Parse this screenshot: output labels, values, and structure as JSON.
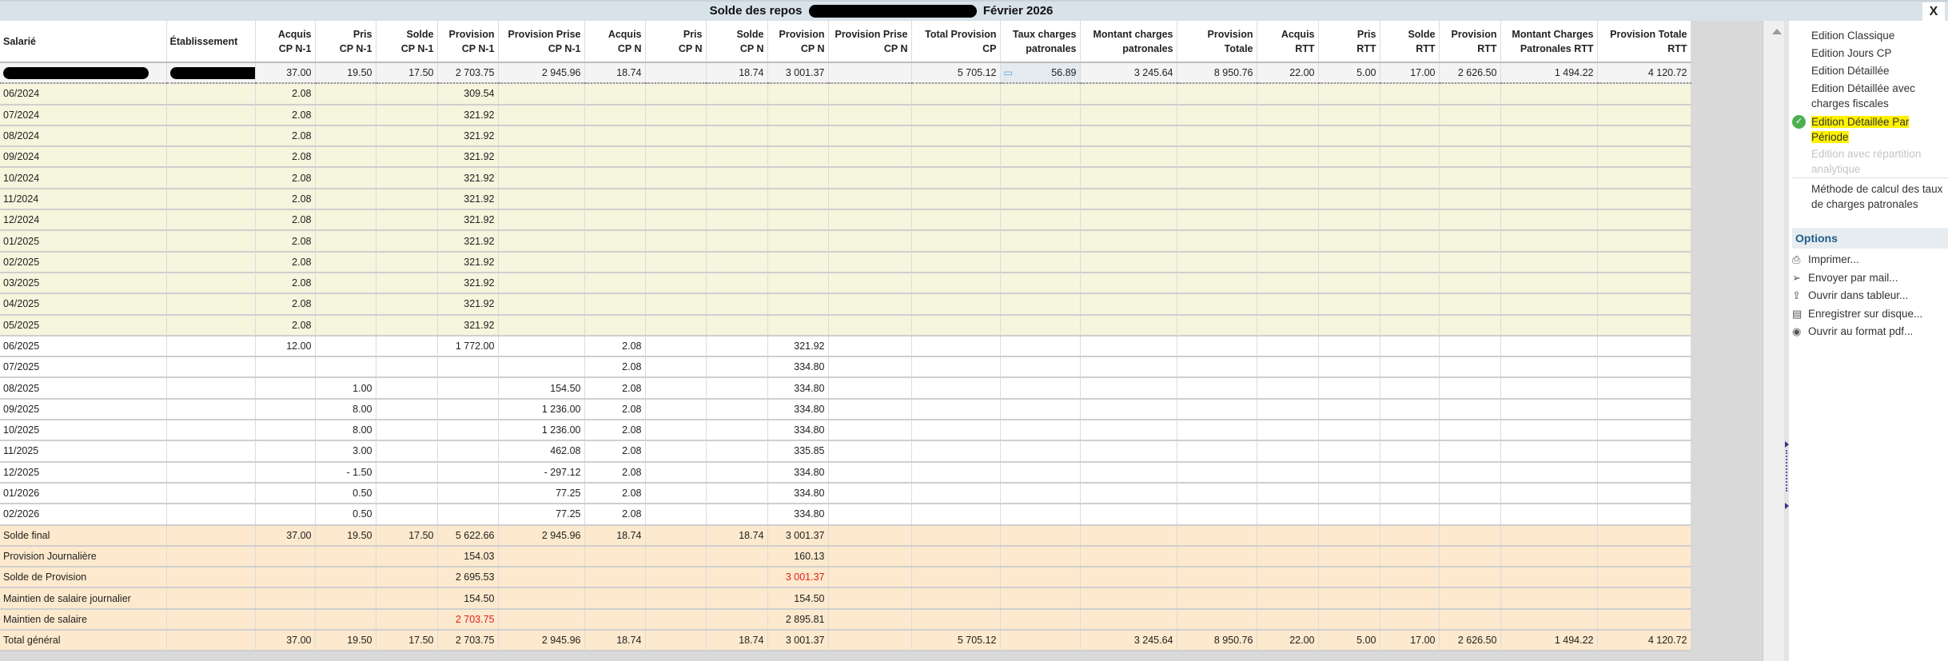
{
  "window": {
    "title_prefix": "Solde des repos",
    "title_suffix": "Février 2026",
    "close_label": "X"
  },
  "columns": [
    [
      "Salarié",
      ""
    ],
    [
      "Établissement",
      ""
    ],
    [
      "Acquis",
      "CP N-1"
    ],
    [
      "Pris",
      "CP N-1"
    ],
    [
      "Solde",
      "CP N-1"
    ],
    [
      "Provision",
      "CP N-1"
    ],
    [
      "Provision Prise",
      "CP N-1"
    ],
    [
      "Acquis",
      "CP N"
    ],
    [
      "Pris",
      "CP N"
    ],
    [
      "Solde",
      "CP N"
    ],
    [
      "Provision",
      "CP N"
    ],
    [
      "Provision Prise",
      "CP N"
    ],
    [
      "Total Provision",
      "CP"
    ],
    [
      "Taux charges",
      "patronales"
    ],
    [
      "Montant charges",
      "patronales"
    ],
    [
      "Provision",
      "Totale"
    ],
    [
      "Acquis",
      "RTT"
    ],
    [
      "Pris",
      "RTT"
    ],
    [
      "Solde",
      "RTT"
    ],
    [
      "Provision",
      "RTT"
    ],
    [
      "Montant Charges",
      "Patronales RTT"
    ],
    [
      "Provision Totale",
      "RTT"
    ]
  ],
  "summary": {
    "values": [
      "37.00",
      "19.50",
      "17.50",
      "2 703.75",
      "2 945.96",
      "18.74",
      "",
      "18.74",
      "3 001.37",
      "",
      "5 705.12",
      "56.89",
      "3 245.64",
      "8 950.76",
      "22.00",
      "5.00",
      "17.00",
      "2 626.50",
      "1 494.22",
      "4 120.72"
    ]
  },
  "rows": [
    {
      "label": "06/2024",
      "style": "yellow",
      "values": [
        "2.08",
        "",
        "",
        "309.54",
        "",
        "",
        "",
        "",
        "",
        "",
        "",
        "",
        "",
        "",
        "",
        "",
        "",
        "",
        "",
        ""
      ]
    },
    {
      "label": "07/2024",
      "style": "yellow",
      "values": [
        "2.08",
        "",
        "",
        "321.92",
        "",
        "",
        "",
        "",
        "",
        "",
        "",
        "",
        "",
        "",
        "",
        "",
        "",
        "",
        "",
        ""
      ]
    },
    {
      "label": "08/2024",
      "style": "yellow",
      "values": [
        "2.08",
        "",
        "",
        "321.92",
        "",
        "",
        "",
        "",
        "",
        "",
        "",
        "",
        "",
        "",
        "",
        "",
        "",
        "",
        "",
        ""
      ]
    },
    {
      "label": "09/2024",
      "style": "yellow",
      "values": [
        "2.08",
        "",
        "",
        "321.92",
        "",
        "",
        "",
        "",
        "",
        "",
        "",
        "",
        "",
        "",
        "",
        "",
        "",
        "",
        "",
        ""
      ]
    },
    {
      "label": "10/2024",
      "style": "yellow",
      "values": [
        "2.08",
        "",
        "",
        "321.92",
        "",
        "",
        "",
        "",
        "",
        "",
        "",
        "",
        "",
        "",
        "",
        "",
        "",
        "",
        "",
        ""
      ]
    },
    {
      "label": "11/2024",
      "style": "yellow",
      "values": [
        "2.08",
        "",
        "",
        "321.92",
        "",
        "",
        "",
        "",
        "",
        "",
        "",
        "",
        "",
        "",
        "",
        "",
        "",
        "",
        "",
        ""
      ]
    },
    {
      "label": "12/2024",
      "style": "yellow",
      "values": [
        "2.08",
        "",
        "",
        "321.92",
        "",
        "",
        "",
        "",
        "",
        "",
        "",
        "",
        "",
        "",
        "",
        "",
        "",
        "",
        "",
        ""
      ]
    },
    {
      "label": "01/2025",
      "style": "yellow",
      "values": [
        "2.08",
        "",
        "",
        "321.92",
        "",
        "",
        "",
        "",
        "",
        "",
        "",
        "",
        "",
        "",
        "",
        "",
        "",
        "",
        "",
        ""
      ]
    },
    {
      "label": "02/2025",
      "style": "yellow",
      "values": [
        "2.08",
        "",
        "",
        "321.92",
        "",
        "",
        "",
        "",
        "",
        "",
        "",
        "",
        "",
        "",
        "",
        "",
        "",
        "",
        "",
        ""
      ]
    },
    {
      "label": "03/2025",
      "style": "yellow",
      "values": [
        "2.08",
        "",
        "",
        "321.92",
        "",
        "",
        "",
        "",
        "",
        "",
        "",
        "",
        "",
        "",
        "",
        "",
        "",
        "",
        "",
        ""
      ]
    },
    {
      "label": "04/2025",
      "style": "yellow",
      "values": [
        "2.08",
        "",
        "",
        "321.92",
        "",
        "",
        "",
        "",
        "",
        "",
        "",
        "",
        "",
        "",
        "",
        "",
        "",
        "",
        "",
        ""
      ]
    },
    {
      "label": "05/2025",
      "style": "yellow",
      "values": [
        "2.08",
        "",
        "",
        "321.92",
        "",
        "",
        "",
        "",
        "",
        "",
        "",
        "",
        "",
        "",
        "",
        "",
        "",
        "",
        "",
        ""
      ]
    },
    {
      "label": "06/2025",
      "style": "white",
      "values": [
        "12.00",
        "",
        "",
        "1 772.00",
        "",
        "2.08",
        "",
        "",
        "321.92",
        "",
        "",
        "",
        "",
        "",
        "",
        "",
        "",
        "",
        "",
        ""
      ]
    },
    {
      "label": "07/2025",
      "style": "white",
      "values": [
        "",
        "",
        "",
        "",
        "",
        "2.08",
        "",
        "",
        "334.80",
        "",
        "",
        "",
        "",
        "",
        "",
        "",
        "",
        "",
        "",
        ""
      ]
    },
    {
      "label": "08/2025",
      "style": "white",
      "values": [
        "",
        "1.00",
        "",
        "",
        "154.50",
        "2.08",
        "",
        "",
        "334.80",
        "",
        "",
        "",
        "",
        "",
        "",
        "",
        "",
        "",
        "",
        ""
      ]
    },
    {
      "label": "09/2025",
      "style": "white",
      "values": [
        "",
        "8.00",
        "",
        "",
        "1 236.00",
        "2.08",
        "",
        "",
        "334.80",
        "",
        "",
        "",
        "",
        "",
        "",
        "",
        "",
        "",
        "",
        ""
      ]
    },
    {
      "label": "10/2025",
      "style": "white",
      "values": [
        "",
        "8.00",
        "",
        "",
        "1 236.00",
        "2.08",
        "",
        "",
        "334.80",
        "",
        "",
        "",
        "",
        "",
        "",
        "",
        "",
        "",
        "",
        ""
      ]
    },
    {
      "label": "11/2025",
      "style": "white",
      "values": [
        "",
        "3.00",
        "",
        "",
        "462.08",
        "2.08",
        "",
        "",
        "335.85",
        "",
        "",
        "",
        "",
        "",
        "",
        "",
        "",
        "",
        "",
        ""
      ]
    },
    {
      "label": "12/2025",
      "style": "white",
      "values": [
        "",
        "- 1.50",
        "",
        "",
        "- 297.12",
        "2.08",
        "",
        "",
        "334.80",
        "",
        "",
        "",
        "",
        "",
        "",
        "",
        "",
        "",
        "",
        ""
      ]
    },
    {
      "label": "01/2026",
      "style": "white",
      "values": [
        "",
        "0.50",
        "",
        "",
        "77.25",
        "2.08",
        "",
        "",
        "334.80",
        "",
        "",
        "",
        "",
        "",
        "",
        "",
        "",
        "",
        "",
        ""
      ]
    },
    {
      "label": "02/2026",
      "style": "white",
      "values": [
        "",
        "0.50",
        "",
        "",
        "77.25",
        "2.08",
        "",
        "",
        "334.80",
        "",
        "",
        "",
        "",
        "",
        "",
        "",
        "",
        "",
        "",
        ""
      ]
    },
    {
      "label": "Solde final",
      "style": "orange",
      "values": [
        "37.00",
        "19.50",
        "17.50",
        "5 622.66",
        "2 945.96",
        "18.74",
        "",
        "18.74",
        "3 001.37",
        "",
        "",
        "",
        "",
        "",
        "",
        "",
        "",
        "",
        "",
        ""
      ]
    },
    {
      "label": "Provision Journalière",
      "style": "orange",
      "values": [
        "",
        "",
        "",
        "154.03",
        "",
        "",
        "",
        "",
        "160.13",
        "",
        "",
        "",
        "",
        "",
        "",
        "",
        "",
        "",
        "",
        ""
      ]
    },
    {
      "label": "Solde de Provision",
      "style": "orange",
      "red": [
        8
      ],
      "values": [
        "",
        "",
        "",
        "2 695.53",
        "",
        "",
        "",
        "",
        "3 001.37",
        "",
        "",
        "",
        "",
        "",
        "",
        "",
        "",
        "",
        "",
        ""
      ]
    },
    {
      "label": "Maintien de salaire journalier",
      "style": "orange",
      "values": [
        "",
        "",
        "",
        "154.50",
        "",
        "",
        "",
        "",
        "154.50",
        "",
        "",
        "",
        "",
        "",
        "",
        "",
        "",
        "",
        "",
        ""
      ]
    },
    {
      "label": "Maintien de salaire",
      "style": "orange",
      "red": [
        3
      ],
      "values": [
        "",
        "",
        "",
        "2 703.75",
        "",
        "",
        "",
        "",
        "2 895.81",
        "",
        "",
        "",
        "",
        "",
        "",
        "",
        "",
        "",
        "",
        ""
      ]
    },
    {
      "label": "Total général",
      "style": "orange",
      "values": [
        "37.00",
        "19.50",
        "17.50",
        "2 703.75",
        "2 945.96",
        "18.74",
        "",
        "18.74",
        "3 001.37",
        "",
        "5 705.12",
        "",
        "3 245.64",
        "8 950.76",
        "22.00",
        "5.00",
        "17.00",
        "2 626.50",
        "1 494.22",
        "4 120.72"
      ]
    }
  ],
  "panel": {
    "editions": [
      {
        "label": "Edition Classique",
        "state": "normal"
      },
      {
        "label": "Edition Jours CP",
        "state": "normal"
      },
      {
        "label": "Edition Détaillée",
        "state": "normal"
      },
      {
        "label": "Edition Détaillée avec charges fiscales",
        "state": "normal"
      },
      {
        "label": "Edition Détaillée Par Période",
        "state": "selected"
      },
      {
        "label": "Edition avec répartition analytique",
        "state": "disabled"
      }
    ],
    "method_label": "Méthode de calcul des taux de charges patronales",
    "options_title": "Options",
    "options": [
      {
        "icon": "printer-icon",
        "glyph": "⎙",
        "label": "Imprimer..."
      },
      {
        "icon": "send-icon",
        "glyph": "➢",
        "label": "Envoyer par mail..."
      },
      {
        "icon": "share-icon",
        "glyph": "⇪",
        "label": "Ouvrir dans tableur..."
      },
      {
        "icon": "save-icon",
        "glyph": "▤",
        "label": "Enregistrer sur disque..."
      },
      {
        "icon": "eye-icon",
        "glyph": "◉",
        "label": "Ouvrir au format pdf..."
      }
    ]
  },
  "colors": {
    "highlight": "#fff200",
    "negative": "#e0201b",
    "accent": "#1f5f8b"
  }
}
